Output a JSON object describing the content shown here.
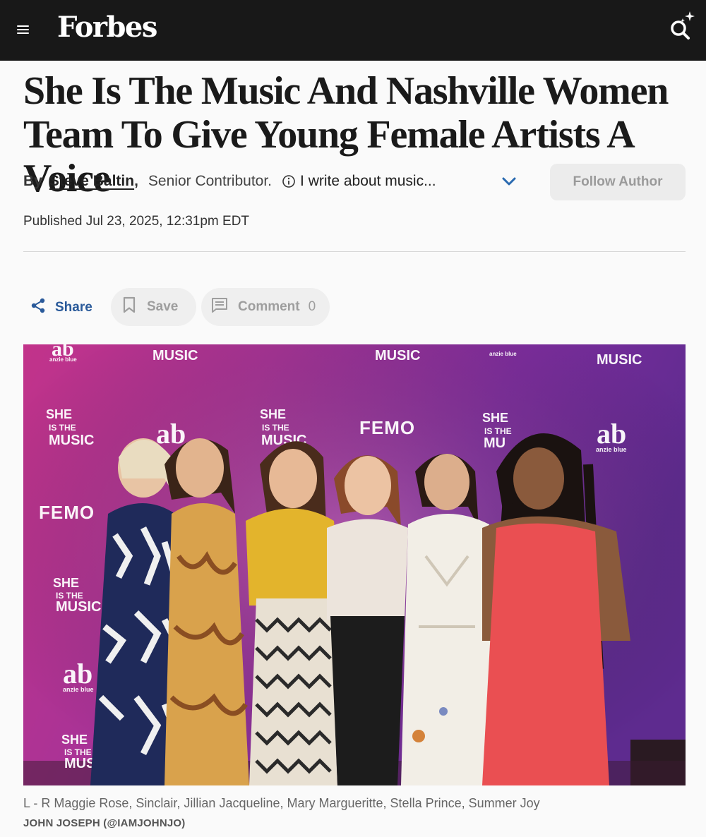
{
  "header": {
    "logo_text": "Forbes",
    "menu_icon": "hamburger-menu-icon",
    "search_icon": "search-sparkle-icon"
  },
  "article": {
    "headline": "She Is The Music And Nashville Women Team To Give Young Female Artists A Voice",
    "byline": {
      "by_label": "By",
      "author": "Steve Baltin",
      "comma": ",",
      "role": "Senior Contributor.",
      "about": "I write about music...",
      "follow_label": "Follow Author"
    },
    "published": "Published Jul 23, 2025, 12:31pm EDT"
  },
  "actions": {
    "share_label": "Share",
    "save_label": "Save",
    "comment_label": "Comment",
    "comment_count": "0"
  },
  "image": {
    "backdrop_texts": [
      "SHE IS THE MUSIC",
      "FEMO",
      "ab",
      "anzie blue"
    ],
    "caption": "L - R Maggie Rose, Sinclair, Jillian Jacqueline, Mary Margueritte, Stella Prince, Summer Joy",
    "credit": "JOHN JOSEPH (@IAMJOHNJO)"
  },
  "colors": {
    "topbar": "#181818",
    "link_blue": "#2a5a9a",
    "backdrop_pink": "#c2338a",
    "backdrop_purple": "#6a2a9a"
  }
}
